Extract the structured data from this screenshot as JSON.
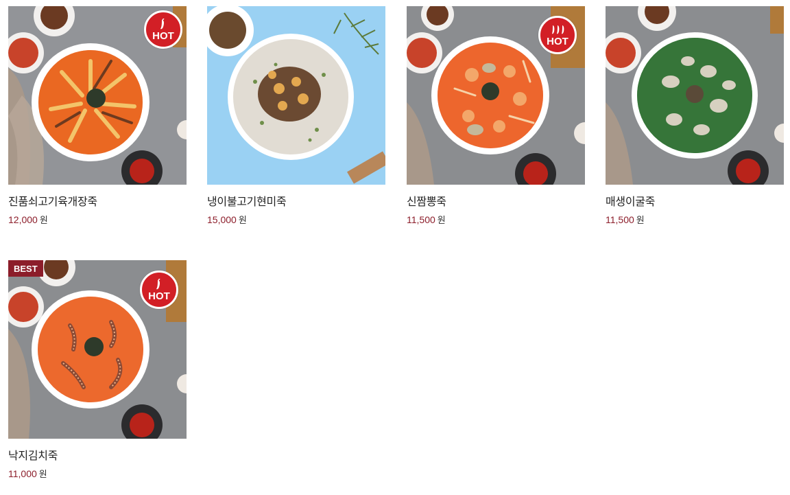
{
  "products": [
    {
      "name": "진품쇠고기육개장죽",
      "price": "12,000",
      "currency": "원",
      "badges": {
        "hot": "HOT"
      },
      "pepper_count": 1,
      "image_theme": "spicy-beef-porridge"
    },
    {
      "name": "냉이불고기현미죽",
      "price": "15,000",
      "currency": "원",
      "badges": {},
      "image_theme": "bulgogi-brown-rice-porridge"
    },
    {
      "name": "신짬뽕죽",
      "price": "11,500",
      "currency": "원",
      "badges": {
        "hot": "HOT"
      },
      "pepper_count": 3,
      "image_theme": "seafood-jjamppong-porridge"
    },
    {
      "name": "매생이굴죽",
      "price": "11,500",
      "currency": "원",
      "badges": {},
      "image_theme": "seaweed-oyster-porridge"
    },
    {
      "name": "낙지김치죽",
      "price": "11,000",
      "currency": "원",
      "badges": {
        "best": "BEST",
        "hot": "HOT"
      },
      "pepper_count": 1,
      "image_theme": "octopus-kimchi-porridge"
    }
  ],
  "colors": {
    "price": "#8c1d2a",
    "hot_badge": "#d21f26",
    "best_badge": "#8c1d2a"
  }
}
